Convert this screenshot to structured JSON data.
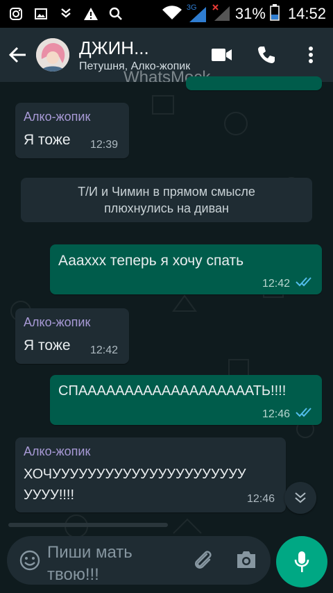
{
  "status_bar": {
    "battery": "31%",
    "time": "14:52",
    "network": "3G"
  },
  "header": {
    "name": "ДЖИН...",
    "subtitle": "Петушня, Алко-жопик",
    "watermark": "WhatsMock"
  },
  "messages": [
    {
      "direction": "in",
      "sender": "Алко-жопик",
      "text": "Я тоже",
      "time": "12:39"
    },
    {
      "direction": "system",
      "text_line1": "Т/И и Чимин в прямом смысле",
      "text_line2": "плюхнулись на диван"
    },
    {
      "direction": "out",
      "text": "Аааххх теперь я хочу спать",
      "time": "12:42",
      "status": "read"
    },
    {
      "direction": "in",
      "sender": "Алко-жопик",
      "text": "Я тоже",
      "time": "12:42"
    },
    {
      "direction": "out",
      "text": "СПАААААААААААААААААААТЬ!!!!",
      "time": "12:46",
      "status": "read"
    },
    {
      "direction": "in",
      "sender": "Алко-жопик",
      "text_line1": "ХОЧУУУУУУУУУУУУУУУУУУУУУУ",
      "text_line2": "УУУУ!!!!",
      "time": "12:46"
    }
  ],
  "composer": {
    "placeholder_line1": "Пиши мать",
    "placeholder_line2": "твою!!!"
  },
  "colors": {
    "header": "#1f2c33",
    "incoming": "#1f2c33",
    "outgoing": "#005c4b",
    "accent": "#00a884",
    "sender": "#a89ad6",
    "read_ticks": "#53bdeb"
  }
}
